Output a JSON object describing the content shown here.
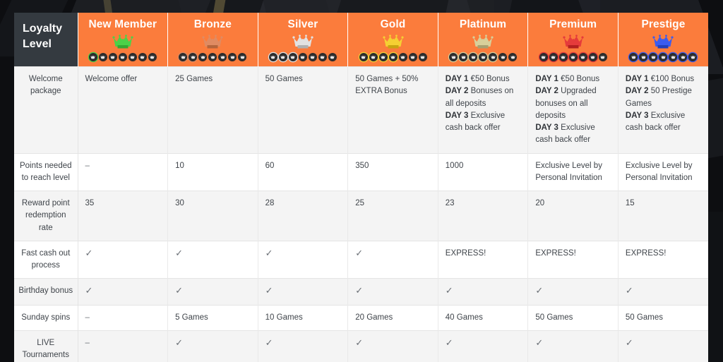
{
  "table": {
    "corner_header": "Loyalty Level",
    "accent_color": "#fb7c3c",
    "header_dark_color": "#343a40",
    "tiers": [
      {
        "name": "New Member",
        "crown_color": "#4bd248",
        "crown_shadow": "#35a832",
        "dots_total": 7,
        "dots_filled": 1
      },
      {
        "name": "Bronze",
        "crown_color": "#e08b62",
        "crown_shadow": "#b4653c",
        "dots_total": 7,
        "dots_filled": 2
      },
      {
        "name": "Silver",
        "crown_color": "#e2e2e2",
        "crown_shadow": "#b0b0b0",
        "dots_total": 7,
        "dots_filled": 3
      },
      {
        "name": "Gold",
        "crown_color": "#f5d033",
        "crown_shadow": "#c9a411",
        "dots_total": 7,
        "dots_filled": 4
      },
      {
        "name": "Platinum",
        "crown_color": "#d8cf9a",
        "crown_shadow": "#a89f70",
        "dots_total": 7,
        "dots_filled": 5
      },
      {
        "name": "Premium",
        "crown_color": "#e53b3b",
        "crown_shadow": "#b32020",
        "dots_total": 7,
        "dots_filled": 6
      },
      {
        "name": "Prestige",
        "crown_color": "#3b5cf0",
        "crown_shadow": "#2440bb",
        "dots_total": 7,
        "dots_filled": 7
      }
    ],
    "rows": [
      {
        "label": "Welcome package",
        "cells": [
          {
            "text": "Welcome offer"
          },
          {
            "text": "25 Games"
          },
          {
            "text": "50 Games"
          },
          {
            "text": "50 Games + 50% EXTRA Bonus"
          },
          {
            "lines": [
              {
                "label": "DAY 1",
                "text": " €50 Bonus"
              },
              {
                "label": "DAY 2",
                "text": " Bonuses on all deposits"
              },
              {
                "label": "DAY 3",
                "text": " Exclusive cash back offer"
              }
            ]
          },
          {
            "lines": [
              {
                "label": "DAY 1",
                "text": " €50 Bonus"
              },
              {
                "label": "DAY 2",
                "text": " Upgraded bonuses on all deposits"
              },
              {
                "label": "DAY 3",
                "text": " Exclusive cash back offer"
              }
            ]
          },
          {
            "lines": [
              {
                "label": "DAY 1",
                "text": " €100 Bonus"
              },
              {
                "label": "DAY 2",
                "text": " 50 Prestige Games"
              },
              {
                "label": "DAY 3",
                "text": " Exclusive cash back offer"
              }
            ]
          }
        ]
      },
      {
        "label": "Points needed to reach level",
        "cells": [
          {
            "text": "–"
          },
          {
            "text": "10"
          },
          {
            "text": "60"
          },
          {
            "text": "350"
          },
          {
            "text": "1000"
          },
          {
            "text": "Exclusive Level by Personal Invitation"
          },
          {
            "text": "Exclusive Level by Personal Invitation"
          }
        ]
      },
      {
        "label": "Reward point redemption rate",
        "cells": [
          {
            "text": "35"
          },
          {
            "text": "30"
          },
          {
            "text": "28"
          },
          {
            "text": "25"
          },
          {
            "text": "23"
          },
          {
            "text": "20"
          },
          {
            "text": "15"
          }
        ]
      },
      {
        "label": "Fast cash out process",
        "cells": [
          {
            "text": "✓"
          },
          {
            "text": "✓"
          },
          {
            "text": "✓"
          },
          {
            "text": "✓"
          },
          {
            "text": "EXPRESS!"
          },
          {
            "text": "EXPRESS!"
          },
          {
            "text": "EXPRESS!"
          }
        ]
      },
      {
        "label": "Birthday bonus",
        "cells": [
          {
            "text": "✓"
          },
          {
            "text": "✓"
          },
          {
            "text": "✓"
          },
          {
            "text": "✓"
          },
          {
            "text": "✓"
          },
          {
            "text": "✓"
          },
          {
            "text": "✓"
          }
        ]
      },
      {
        "label": "Sunday spins",
        "cells": [
          {
            "text": "–"
          },
          {
            "text": "5 Games"
          },
          {
            "text": "10 Games"
          },
          {
            "text": "20 Games"
          },
          {
            "text": "40 Games"
          },
          {
            "text": "50 Games"
          },
          {
            "text": "50 Games"
          }
        ]
      },
      {
        "label": "LIVE Tournaments",
        "cells": [
          {
            "text": "–"
          },
          {
            "text": "✓"
          },
          {
            "text": "✓"
          },
          {
            "text": "✓"
          },
          {
            "text": "✓"
          },
          {
            "text": "✓"
          },
          {
            "text": "✓"
          }
        ]
      }
    ]
  }
}
